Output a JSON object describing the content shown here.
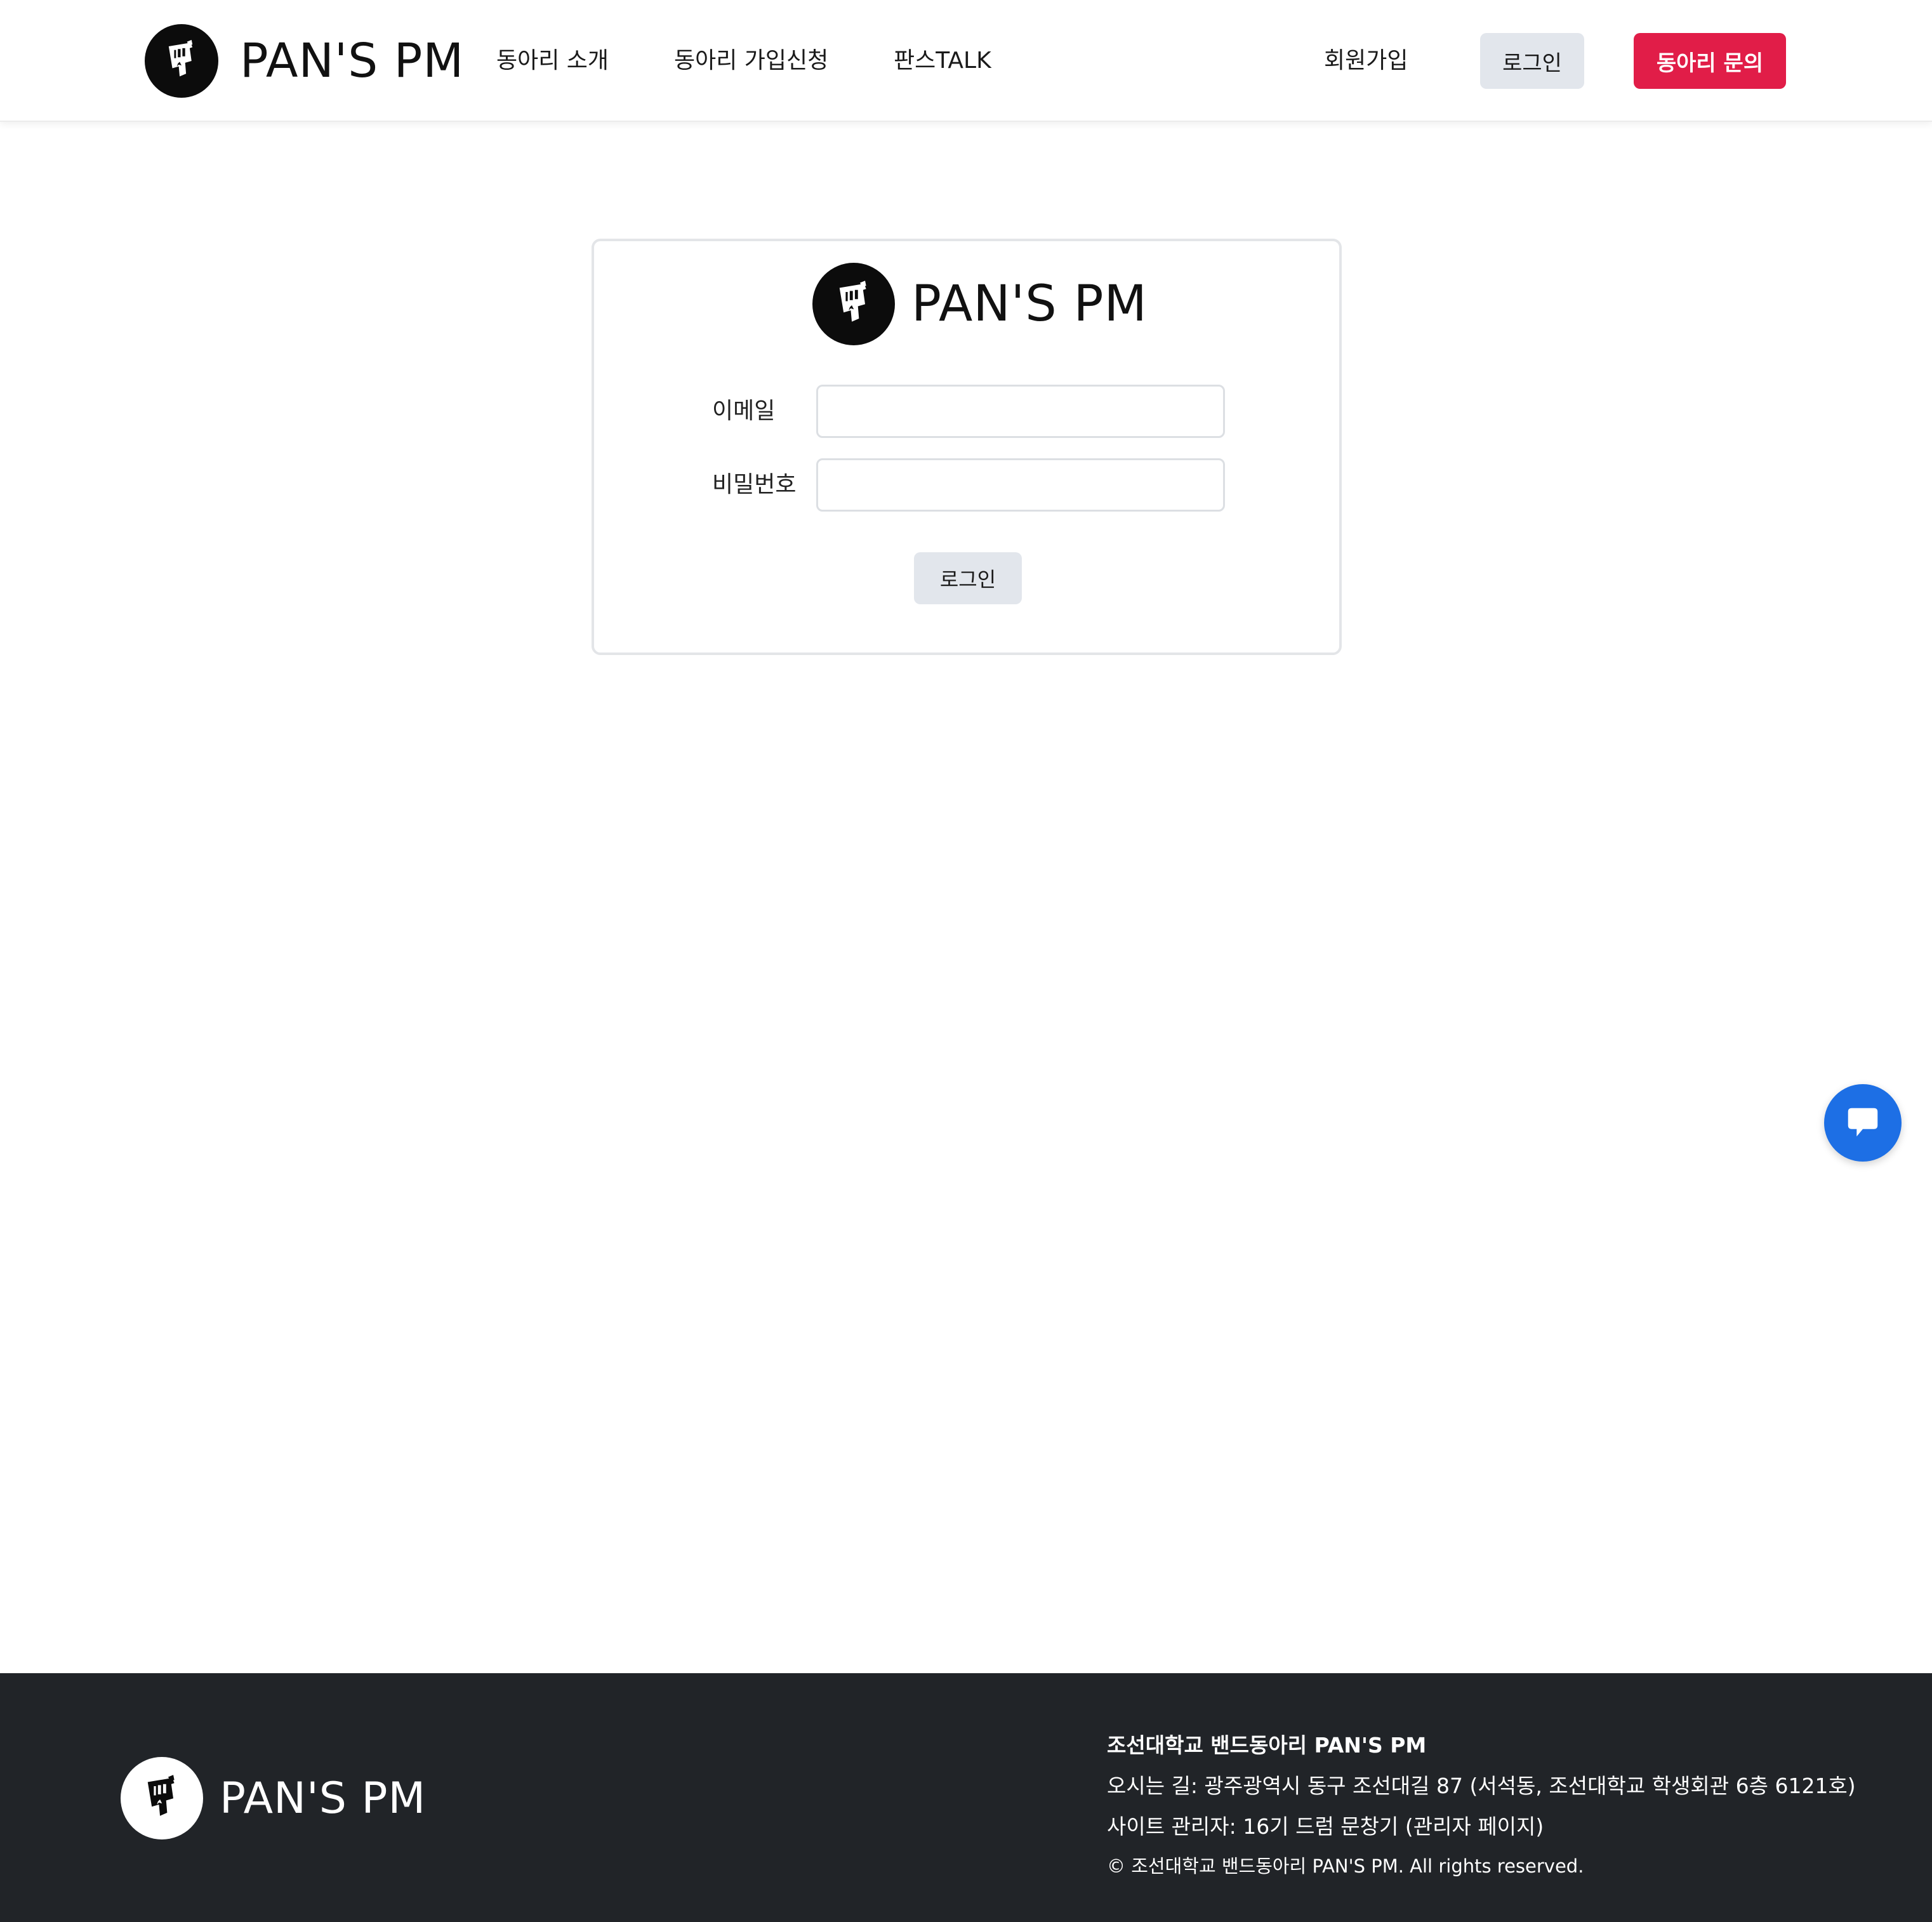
{
  "header": {
    "brand": "PAN'S PM",
    "nav": [
      "동아리 소개",
      "동아리 가입신청",
      "판스TALK"
    ],
    "signup": "회원가입",
    "login": "로그인",
    "inquiry": "동아리 문의"
  },
  "login_card": {
    "brand": "PAN'S PM",
    "email_label": "이메일",
    "email_value": "",
    "password_label": "비밀번호",
    "password_value": "",
    "submit": "로그인"
  },
  "footer": {
    "brand": "PAN'S PM",
    "org": "조선대학교 밴드동아리 PAN'S PM",
    "address": "오시는 길: 광주광역시 동구 조선대길 87 (서석동, 조선대학교 학생회관 6층 6121호)",
    "admin": "사이트 관리자: 16기 드럼 문창기  (관리자 페이지)",
    "copyright": "© 조선대학교 밴드동아리 PAN'S PM. All rights reserved."
  },
  "icons": {
    "logo": "pans-pm-logo-icon",
    "chat": "chat-bubble-icon"
  },
  "colors": {
    "accent_red": "#e11d48",
    "chat_blue": "#1d6fe5",
    "footer_bg": "#212428",
    "button_gray": "#e2e6ec"
  }
}
